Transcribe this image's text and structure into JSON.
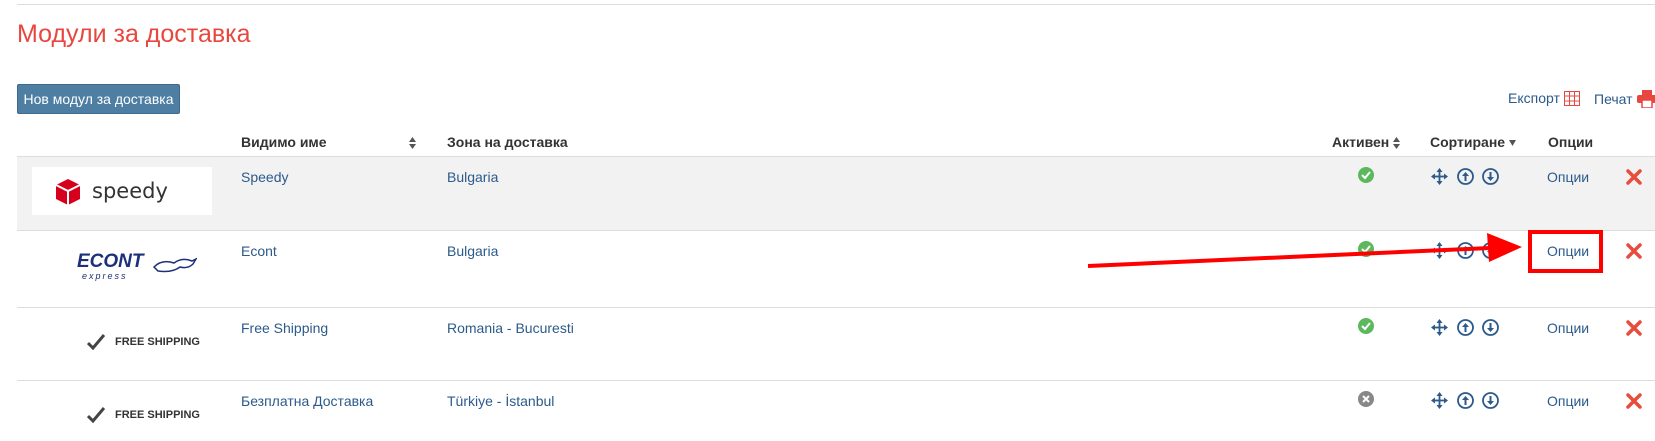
{
  "page": {
    "title": "Модули за доставка"
  },
  "toolbar": {
    "new_button": "Нов модул за доставка",
    "export_label": "Експорт",
    "print_label": "Печат"
  },
  "table": {
    "headers": {
      "name": "Видимо име",
      "zone": "Зона на доставка",
      "active": "Активен",
      "sort": "Сортиране",
      "options": "Опции"
    },
    "rows": [
      {
        "logo": "speedy",
        "logo_text": "speedy",
        "name": "Speedy",
        "zone": "Bulgaria",
        "active": true,
        "options": "Опции"
      },
      {
        "logo": "econt",
        "logo_text": "ECONT",
        "logo_subtext": "express",
        "name": "Econt",
        "zone": "Bulgaria",
        "active": true,
        "options": "Опции"
      },
      {
        "logo": "free-shipping",
        "logo_text": "FREE SHIPPING",
        "name": "Free Shipping",
        "zone": "Romania - Bucuresti",
        "active": true,
        "options": "Опции"
      },
      {
        "logo": "free-shipping",
        "logo_text": "FREE SHIPPING",
        "name": "Безплатна Доставка",
        "zone": "Türkiye - İstanbul",
        "active": false,
        "options": "Опции"
      }
    ]
  },
  "colors": {
    "accent_red": "#e8473f",
    "link_blue": "#2c5a8a",
    "button_blue": "#4e7ea2",
    "active_green": "#5cb85c",
    "inactive_gray": "#888888",
    "delete_red": "#e74c3c",
    "annotation_red": "#ff0000"
  },
  "icons": {
    "export": "table-grid-icon",
    "print": "printer-icon",
    "move": "move-arrows-icon",
    "up": "circle-arrow-up-icon",
    "down": "circle-arrow-down-icon",
    "delete": "close-x-icon",
    "active": "check-circle-icon",
    "inactive": "x-circle-icon"
  }
}
